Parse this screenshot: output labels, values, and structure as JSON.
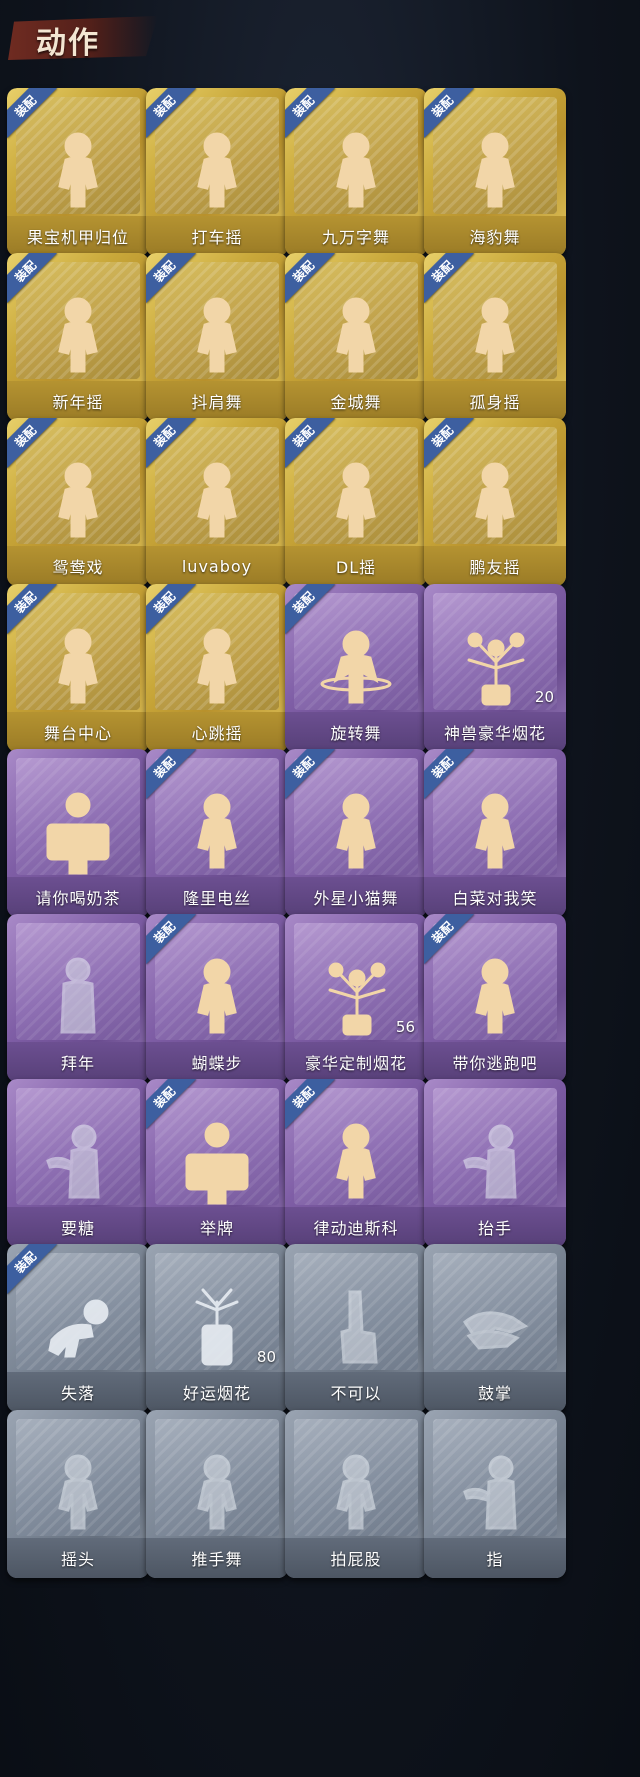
{
  "header": {
    "title": "动作"
  },
  "badge_text": "装配",
  "colors": {
    "gold": "#c9a83a",
    "purple": "#7f5ea6",
    "silver": "#7a8594",
    "badge": "#3d5fa0"
  },
  "items": [
    {
      "label": "果宝机甲归位",
      "rarity": "gold",
      "equipped": true,
      "icon": "dance-figure-icon"
    },
    {
      "label": "打车摇",
      "rarity": "gold",
      "equipped": true,
      "icon": "dance-figure-icon"
    },
    {
      "label": "九万字舞",
      "rarity": "gold",
      "equipped": true,
      "icon": "dance-figure-icon"
    },
    {
      "label": "海豹舞",
      "rarity": "gold",
      "equipped": true,
      "icon": "dance-figure-icon"
    },
    {
      "label": "新年摇",
      "rarity": "gold",
      "equipped": true,
      "icon": "dance-figure-icon"
    },
    {
      "label": "抖肩舞",
      "rarity": "gold",
      "equipped": true,
      "icon": "dance-figure-icon"
    },
    {
      "label": "金城舞",
      "rarity": "gold",
      "equipped": true,
      "icon": "dance-figure-icon"
    },
    {
      "label": "孤身摇",
      "rarity": "gold",
      "equipped": true,
      "icon": "dance-figure-icon"
    },
    {
      "label": "鸳鸯戏",
      "rarity": "gold",
      "equipped": true,
      "icon": "dance-figure-icon"
    },
    {
      "label": "luvaboy",
      "rarity": "gold",
      "equipped": true,
      "icon": "dance-figure-icon"
    },
    {
      "label": "DL摇",
      "rarity": "gold",
      "equipped": true,
      "icon": "dance-figure-icon"
    },
    {
      "label": "鹏友摇",
      "rarity": "gold",
      "equipped": true,
      "icon": "dance-figure-icon"
    },
    {
      "label": "舞台中心",
      "rarity": "gold",
      "equipped": true,
      "icon": "dance-figure-icon"
    },
    {
      "label": "心跳摇",
      "rarity": "gold",
      "equipped": true,
      "icon": "dance-figure-icon"
    },
    {
      "label": "旋转舞",
      "rarity": "purple",
      "equipped": true,
      "icon": "spin-figure-icon"
    },
    {
      "label": "神兽豪华烟花",
      "rarity": "purple",
      "equipped": false,
      "icon": "fireworks-icon",
      "count": "20"
    },
    {
      "label": "请你喝奶茶",
      "rarity": "purple",
      "equipped": false,
      "icon": "sign-figure-icon"
    },
    {
      "label": "隆里电丝",
      "rarity": "purple",
      "equipped": true,
      "icon": "dance-figure-icon"
    },
    {
      "label": "外星小猫舞",
      "rarity": "purple",
      "equipped": true,
      "icon": "dance-figure-icon"
    },
    {
      "label": "白菜对我笑",
      "rarity": "purple",
      "equipped": true,
      "icon": "dance-figure-icon"
    },
    {
      "label": "拜年",
      "rarity": "purple",
      "equipped": false,
      "icon": "bow-figure-icon",
      "dim": true
    },
    {
      "label": "蝴蝶步",
      "rarity": "purple",
      "equipped": true,
      "icon": "dance-figure-icon"
    },
    {
      "label": "豪华定制烟花",
      "rarity": "purple",
      "equipped": false,
      "icon": "fireworks-icon",
      "count": "56"
    },
    {
      "label": "带你逃跑吧",
      "rarity": "purple",
      "equipped": true,
      "icon": "dance-figure-icon"
    },
    {
      "label": "要糖",
      "rarity": "purple",
      "equipped": false,
      "icon": "hand-figure-icon",
      "dim": true
    },
    {
      "label": "举牌",
      "rarity": "purple",
      "equipped": true,
      "icon": "sign-figure-icon"
    },
    {
      "label": "律动迪斯科",
      "rarity": "purple",
      "equipped": true,
      "icon": "dance-figure-icon"
    },
    {
      "label": "抬手",
      "rarity": "purple",
      "equipped": false,
      "icon": "hand-figure-icon",
      "dim": true
    },
    {
      "label": "失落",
      "rarity": "silver",
      "equipped": true,
      "icon": "crawl-figure-icon"
    },
    {
      "label": "好运烟花",
      "rarity": "silver",
      "equipped": false,
      "icon": "firecracker-icon",
      "count": "80"
    },
    {
      "label": "不可以",
      "rarity": "silver",
      "equipped": false,
      "icon": "finger-icon",
      "dim": true
    },
    {
      "label": "鼓掌",
      "rarity": "silver",
      "equipped": false,
      "icon": "clap-icon",
      "dim": true
    },
    {
      "label": "摇头",
      "rarity": "silver",
      "equipped": false,
      "icon": "dance-figure-icon",
      "dim": true
    },
    {
      "label": "推手舞",
      "rarity": "silver",
      "equipped": false,
      "icon": "dance-figure-icon",
      "dim": true
    },
    {
      "label": "拍屁股",
      "rarity": "silver",
      "equipped": false,
      "icon": "dance-figure-icon",
      "dim": true
    },
    {
      "label": "指",
      "rarity": "silver",
      "equipped": false,
      "icon": "hand-figure-icon",
      "dim": true
    }
  ]
}
